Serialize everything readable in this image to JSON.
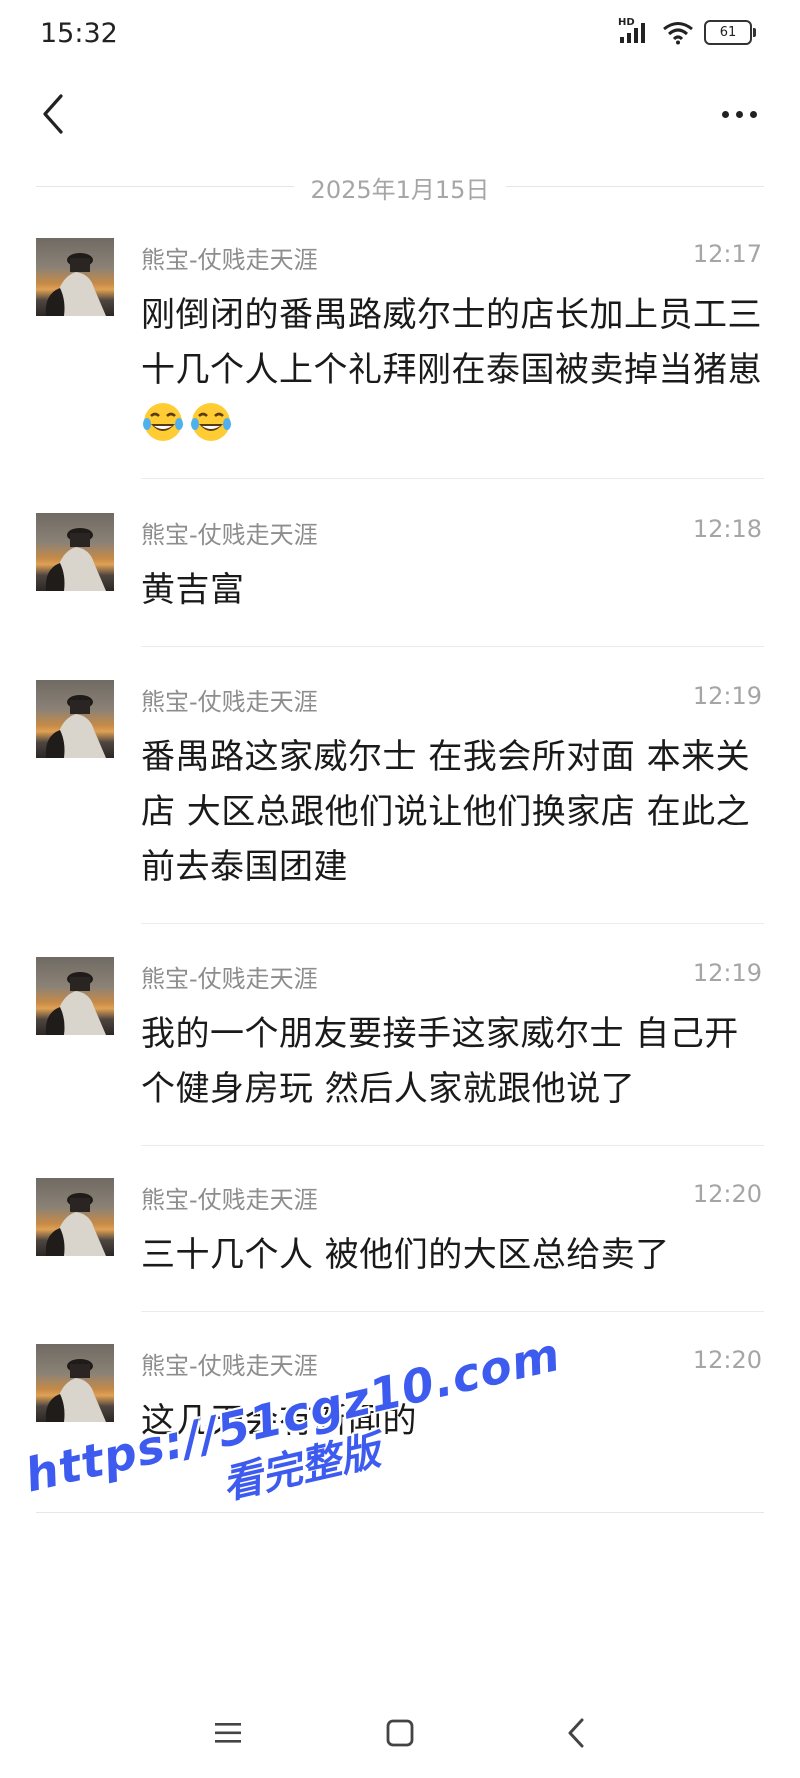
{
  "status_bar": {
    "time": "15:32",
    "network_label": "HD",
    "battery_level": "61"
  },
  "header": {
    "back_icon": "chevron-left-icon",
    "more_icon": "more-horizontal-icon"
  },
  "date_divider": "2025年1月15日",
  "messages": [
    {
      "sender": "熊宝-仗贱走天涯",
      "time": "12:17",
      "text": "刚倒闭的番禺路威尔士的店长加上员工三十几个人上个礼拜刚在泰国被卖掉当猪崽",
      "emoji": [
        "tears-of-joy-emoji",
        "tears-of-joy-emoji"
      ]
    },
    {
      "sender": "熊宝-仗贱走天涯",
      "time": "12:18",
      "text": "黄吉富"
    },
    {
      "sender": "熊宝-仗贱走天涯",
      "time": "12:19",
      "text": "番禺路这家威尔士 在我会所对面 本来关店 大区总跟他们说让他们换家店 在此之前去泰国团建"
    },
    {
      "sender": "熊宝-仗贱走天涯",
      "time": "12:19",
      "text": "我的一个朋友要接手这家威尔士 自己开个健身房玩 然后人家就跟他说了"
    },
    {
      "sender": "熊宝-仗贱走天涯",
      "time": "12:20",
      "text": "三十几个人 被他们的大区总给卖了"
    },
    {
      "sender": "熊宝-仗贱走天涯",
      "time": "12:20",
      "text": "这几天会有新闻的"
    }
  ],
  "watermark": {
    "url": "https://51cgz10.com",
    "subtitle": "看完整版",
    "color": "#3e5bf0"
  },
  "nav_bar": {
    "menu_icon": "menu-icon",
    "home_icon": "home-square-icon",
    "back_icon": "back-triangle-icon"
  }
}
